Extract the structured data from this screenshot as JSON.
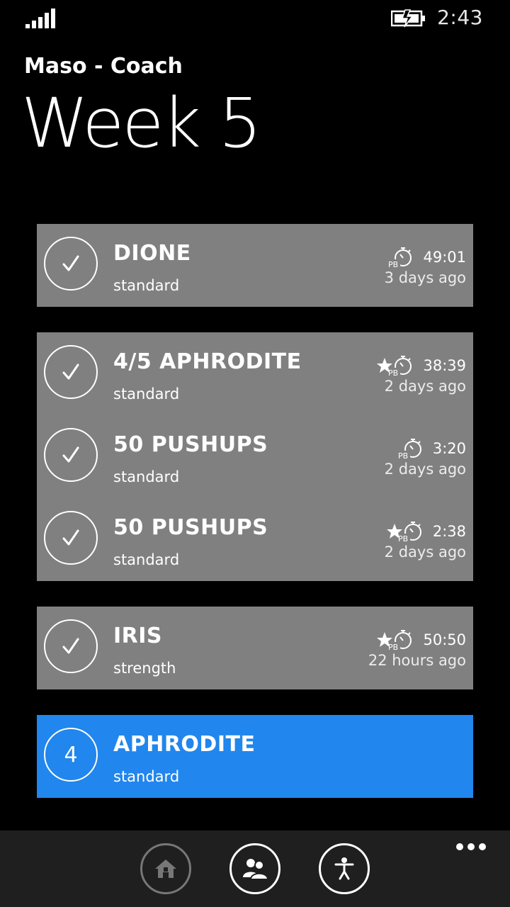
{
  "status_bar": {
    "time": "2:43",
    "signal_icon": "signal-bars-icon",
    "battery_icon": "battery-charging-icon"
  },
  "header": {
    "app_title": "Maso - Coach",
    "page_title": "Week 5"
  },
  "colors": {
    "background": "#000000",
    "card_gray": "#808080",
    "accent_blue": "#2186ed",
    "app_bar": "#1f1f1f"
  },
  "groups": [
    {
      "workouts": [
        {
          "name": "DIONE",
          "type": "standard",
          "time": "49:01",
          "ago": "3 days ago",
          "status": "check",
          "badges": [
            "personal-best-stopwatch-icon"
          ]
        }
      ]
    },
    {
      "workouts": [
        {
          "name": "4/5 APHRODITE",
          "type": "standard",
          "time": "38:39",
          "ago": "2 days ago",
          "status": "check",
          "badges": [
            "star-icon",
            "personal-best-stopwatch-icon"
          ]
        },
        {
          "name": "50 PUSHUPS",
          "type": "standard",
          "time": "3:20",
          "ago": "2 days ago",
          "status": "check",
          "badges": [
            "personal-best-stopwatch-icon"
          ]
        },
        {
          "name": "50 PUSHUPS",
          "type": "standard",
          "time": "2:38",
          "ago": "2 days ago",
          "status": "check",
          "badges": [
            "star-icon",
            "personal-best-stopwatch-icon"
          ]
        }
      ]
    },
    {
      "workouts": [
        {
          "name": "IRIS",
          "type": "strength",
          "time": "50:50",
          "ago": "22 hours ago",
          "status": "check",
          "badges": [
            "star-icon",
            "personal-best-stopwatch-icon"
          ]
        }
      ]
    },
    {
      "active": true,
      "workouts": [
        {
          "name": "APHRODITE",
          "type": "standard",
          "number": "4",
          "status": "number"
        }
      ]
    }
  ],
  "app_bar": {
    "buttons": [
      "home-icon",
      "people-icon",
      "person-icon"
    ],
    "more_icon": "ellipsis-icon"
  }
}
